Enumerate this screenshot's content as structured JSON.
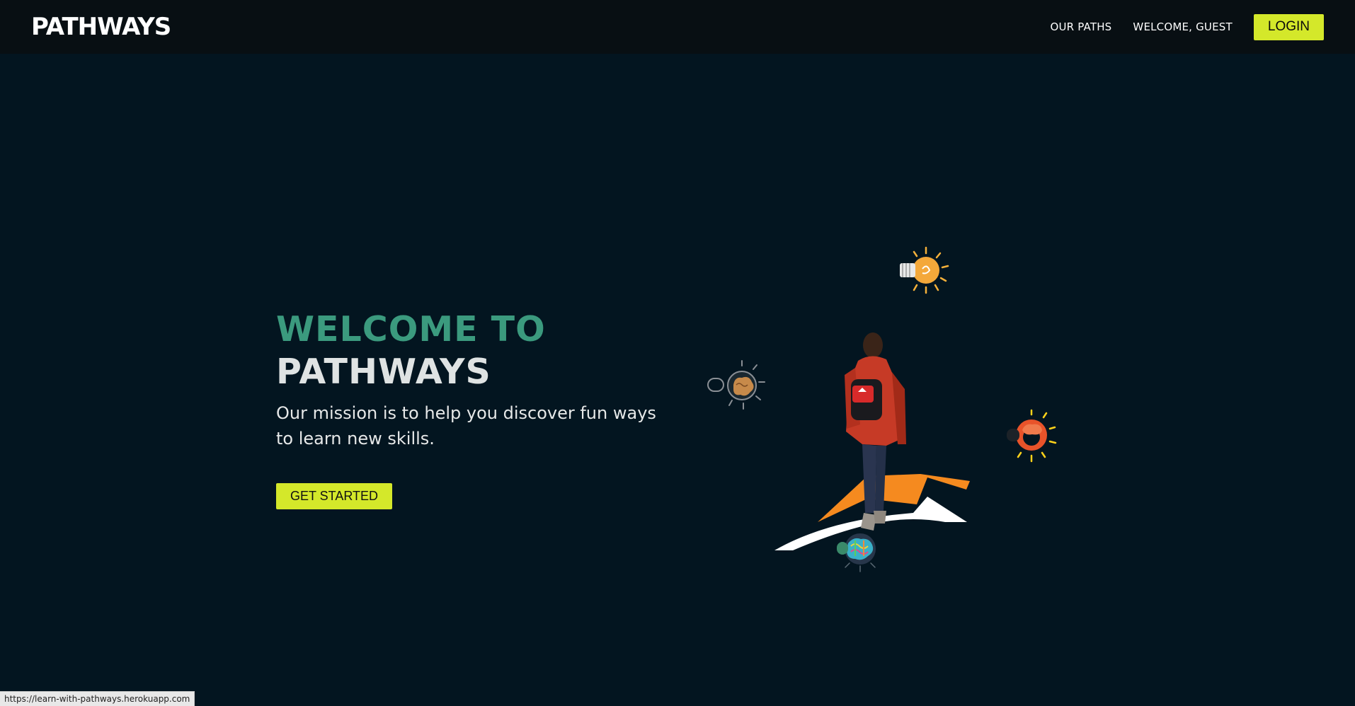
{
  "navbar": {
    "logo_text": "PATHWAYS",
    "links": [
      {
        "label": "OUR PATHS"
      },
      {
        "label": "WELCOME, GUEST"
      }
    ],
    "login_label": "LOGIN"
  },
  "hero": {
    "title_line1": "WELCOME TO",
    "title_line2": "PATHWAYS",
    "mission": "Our mission is to help you discover fun ways to learn new skills.",
    "cta_label": "GET STARTED"
  },
  "illustration": {
    "icons": [
      "lightbulb-icon",
      "brain-lightbulb-icon",
      "brain-gear-icon",
      "colorful-brain-icon",
      "person-backpack-figure",
      "arrow-path-icon"
    ]
  },
  "status_bar": {
    "url": "https://learn-with-pathways.herokuapp.com"
  },
  "colors": {
    "background": "#031520",
    "navbar": "#080f13",
    "accent_button": "#d4e82a",
    "title_teal": "#3b9a7e",
    "title_white": "#dfe3e3"
  }
}
